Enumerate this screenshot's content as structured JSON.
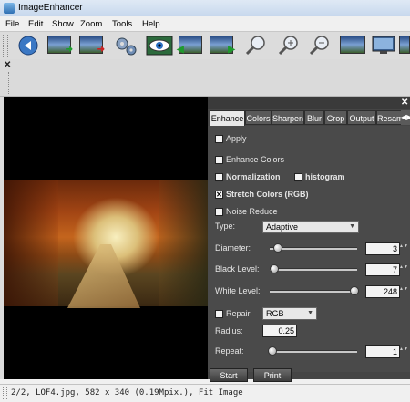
{
  "window": {
    "title": "ImageEnhancer"
  },
  "menu": [
    "File",
    "Edit",
    "Show",
    "Zoom",
    "Tools",
    "Help"
  ],
  "toolbar": {
    "icons": [
      "back-icon",
      "image-to-green-arrow-icon",
      "image-to-red-arrow-icon",
      "gears-icon",
      "eye-icon",
      "image-back-arrow-icon",
      "image-forward-arrow-icon",
      "zoom-icon",
      "zoom-in-icon",
      "zoom-out-icon",
      "image-thumbnail-icon",
      "monitor-icon",
      "image-frame-icon"
    ]
  },
  "panel": {
    "tabs": [
      "Enhance",
      "Colors",
      "Sharpen",
      "Blur",
      "Crop",
      "Output",
      "Resam"
    ],
    "active_tab": "Enhance",
    "apply": {
      "label": "Apply",
      "checked": false
    },
    "enhance_colors": {
      "label": "Enhance Colors",
      "checked": false
    },
    "normalization": {
      "label": "Normalization",
      "checked": false
    },
    "histogram": {
      "label": "histogram",
      "checked": false
    },
    "stretch_colors": {
      "label": "Stretch Colors (RGB)",
      "checked": true,
      "mark": "✕"
    },
    "noise_reduce": {
      "label": "Noise Reduce",
      "checked": false
    },
    "type": {
      "label": "Type:",
      "value": "Adaptive"
    },
    "diameter": {
      "label": "Diameter:",
      "value": "3",
      "level": 0.02
    },
    "black_level": {
      "label": "Black Level:",
      "value": "7",
      "level": 0.03
    },
    "white_level": {
      "label": "White Level:",
      "value": "248",
      "level": 0.97
    },
    "repair": {
      "label": "Repair",
      "checked": false,
      "mode": "RGB"
    },
    "radius": {
      "label": "Radius:",
      "value": "0.25"
    },
    "repeat": {
      "label": "Repeat:",
      "value": "1",
      "level": 0.0
    },
    "buttons": {
      "start": "Start",
      "print": "Print"
    }
  },
  "status": {
    "text": "2/2, LOF4.jpg, 582 x 340 (0.19Mpix.), Fit Image"
  },
  "colors": {
    "panel_bg": "#4a4a4a",
    "viewer_bg": "#000000",
    "tab_active": "#e8e8e8"
  }
}
